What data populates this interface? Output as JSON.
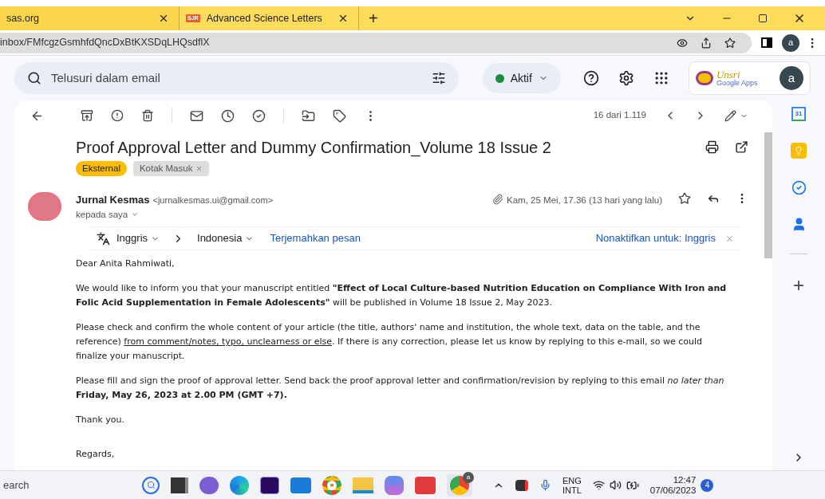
{
  "browser": {
    "tabs": [
      {
        "title": "sas.org",
        "selected": false
      },
      {
        "title": "Advanced Science Letters",
        "favicon": "SJR",
        "selected": true
      }
    ],
    "new_tab": "+",
    "url": "inbox/FMfcgzGsmhfdQncDxBtKXSDqLHQsdflX",
    "profile": "a"
  },
  "gmail": {
    "search_placeholder": "Telusuri dalam email",
    "status": {
      "label": "Aktif",
      "online": true
    },
    "logo_text": "Unsri",
    "logo_sub": "Google Apps",
    "account": "a"
  },
  "toolbar": {
    "counter": "16 dari 1.119"
  },
  "email": {
    "subject": "Proof Approval Letter and Dummy Confirmation_Volume 18 Issue 2",
    "labels": [
      {
        "text": "Eksternal",
        "kind": "tag",
        "color": "#fbbc04"
      },
      {
        "text": "Kotak Masuk",
        "kind": "removable",
        "color": "#dddddd"
      }
    ],
    "sender_name": "Jurnal Kesmas",
    "sender_email": "<jurnalkesmas.ui@gmail.com>",
    "recipient": "kepada saya",
    "date": "Kam, 25 Mei, 17.36 (13 hari yang lalu)",
    "starred": false,
    "has_attachment": true,
    "translate": {
      "from": "Inggris",
      "to": "Indonesia",
      "action": "Terjemahkan pesan",
      "disable": "Nonaktifkan untuk: Inggris"
    },
    "paragraphs": [
      {
        "segments": [
          {
            "text": "Dear Anita Rahmiwati,",
            "kind": "normal"
          }
        ]
      },
      {
        "segments": [
          {
            "text": "We would like to inform you that your manuscript entitled ",
            "kind": "normal"
          },
          {
            "text": "\"Effect of Local Culture-based Nutrition Education on Compliance With Iron and Folic Acid Supplementation in Female Adolescents\"",
            "kind": "bold"
          },
          {
            "text": " will be published in Volume 18 Issue 2, May 2023.",
            "kind": "normal"
          }
        ]
      },
      {
        "segments": [
          {
            "text": "Please check and confirm the whole content of your article (the title, authors' name and institution, the whole text, data on the table, and the reference) ",
            "kind": "normal"
          },
          {
            "text": "from comment/notes, typo, unclearness or else",
            "kind": "underline"
          },
          {
            "text": ". If there is any correction, please let us know by replying to this e-mail, so we could finalize your manuscript.",
            "kind": "normal"
          }
        ]
      },
      {
        "segments": [
          {
            "text": "Please fill and sign the proof of approval letter. Send back the proof approval letter and confirmation/revision by replying to this email ",
            "kind": "normal"
          },
          {
            "text": "no later than",
            "kind": "italic"
          },
          {
            "text": " Friday, May 26, 2023 at 2.00 PM (GMT +7).",
            "kind": "bold"
          }
        ]
      },
      {
        "segments": [
          {
            "text": "Thank you.",
            "kind": "normal"
          }
        ]
      },
      {
        "segments": [
          {
            "text": "Regards,",
            "kind": "normal"
          }
        ]
      }
    ]
  },
  "side_panel": {
    "calendar_day": "31",
    "add": "+"
  },
  "taskbar": {
    "search": "earch",
    "pinned_badge": "a",
    "language": "ENG",
    "layout": "INTL",
    "time": "12:47",
    "date": "07/06/2023",
    "notifications": "4"
  }
}
